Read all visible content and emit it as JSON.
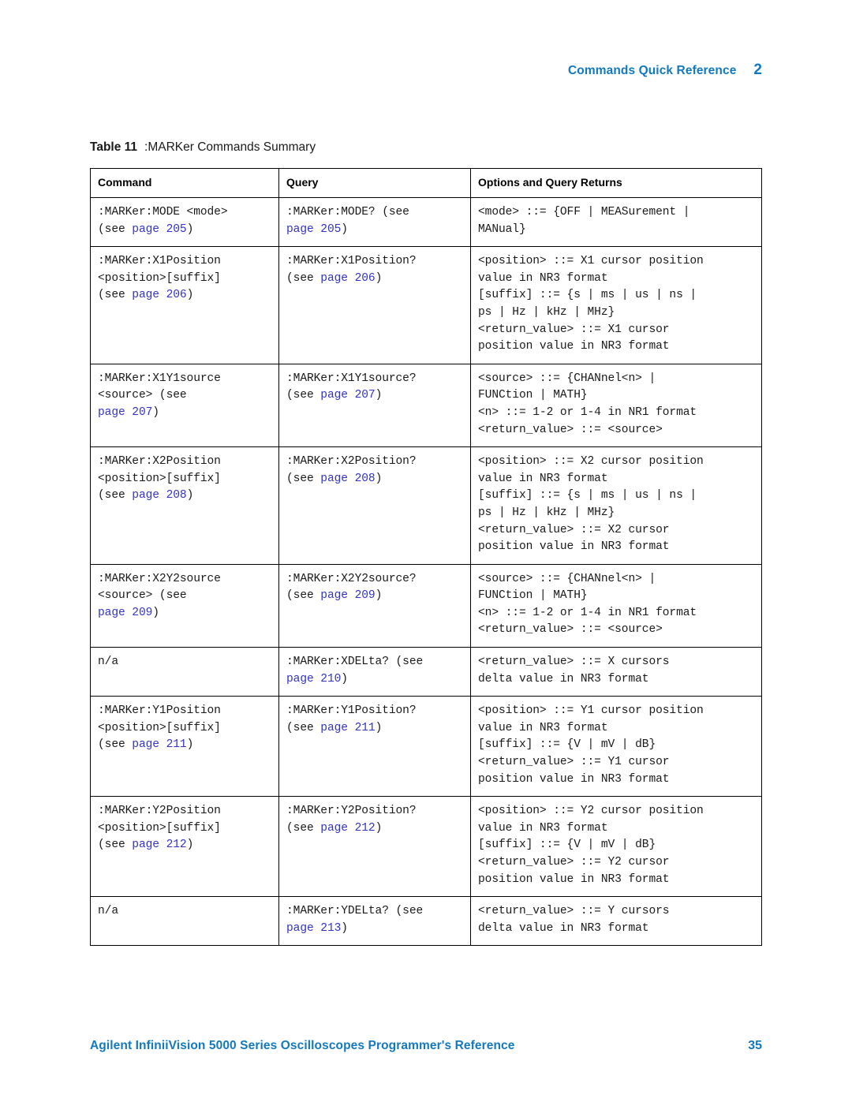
{
  "header": {
    "title": "Commands Quick Reference",
    "chapter": "2"
  },
  "caption": {
    "label": "Table 11",
    "text": ":MARKer Commands Summary"
  },
  "table": {
    "columns": [
      "Command",
      "Query",
      "Options and Query Returns"
    ],
    "rows": [
      {
        "command": [
          [
            {
              "t": ":MARKer:MODE <mode>"
            }
          ],
          [
            {
              "t": "(see "
            },
            {
              "t": "page 205",
              "link": true
            },
            {
              "t": ")"
            }
          ]
        ],
        "query": [
          [
            {
              "t": ":MARKer:MODE? (see"
            }
          ],
          [
            {
              "t": "page 205",
              "link": true
            },
            {
              "t": ")"
            }
          ]
        ],
        "options": [
          [
            {
              "t": "<mode> ::= {OFF | MEASurement |"
            }
          ],
          [
            {
              "t": "MANual}"
            }
          ]
        ]
      },
      {
        "command": [
          [
            {
              "t": ":MARKer:X1Position"
            }
          ],
          [
            {
              "t": "<position>[suffix]"
            }
          ],
          [
            {
              "t": "(see "
            },
            {
              "t": "page 206",
              "link": true
            },
            {
              "t": ")"
            }
          ]
        ],
        "query": [
          [
            {
              "t": ":MARKer:X1Position?"
            }
          ],
          [
            {
              "t": "(see "
            },
            {
              "t": "page 206",
              "link": true
            },
            {
              "t": ")"
            }
          ]
        ],
        "options": [
          [
            {
              "t": "<position> ::= X1 cursor position"
            }
          ],
          [
            {
              "t": "value in NR3 format"
            }
          ],
          [
            {
              "t": "[suffix] ::= {s | ms | us | ns |"
            }
          ],
          [
            {
              "t": "ps | Hz | kHz | MHz}"
            }
          ],
          [
            {
              "t": "<return_value> ::= X1 cursor"
            }
          ],
          [
            {
              "t": "position value in NR3 format"
            }
          ]
        ]
      },
      {
        "command": [
          [
            {
              "t": ":MARKer:X1Y1source"
            }
          ],
          [
            {
              "t": "<source> (see"
            }
          ],
          [
            {
              "t": "page 207",
              "link": true
            },
            {
              "t": ")"
            }
          ]
        ],
        "query": [
          [
            {
              "t": ":MARKer:X1Y1source?"
            }
          ],
          [
            {
              "t": "(see "
            },
            {
              "t": "page 207",
              "link": true
            },
            {
              "t": ")"
            }
          ]
        ],
        "options": [
          [
            {
              "t": "<source> ::= {CHANnel<n> |"
            }
          ],
          [
            {
              "t": "FUNCtion | MATH}"
            }
          ],
          [
            {
              "t": "<n> ::= 1-2 or 1-4 in NR1 format"
            }
          ],
          [
            {
              "t": "<return_value> ::= <source>"
            }
          ]
        ]
      },
      {
        "command": [
          [
            {
              "t": ":MARKer:X2Position"
            }
          ],
          [
            {
              "t": "<position>[suffix]"
            }
          ],
          [
            {
              "t": "(see "
            },
            {
              "t": "page 208",
              "link": true
            },
            {
              "t": ")"
            }
          ]
        ],
        "query": [
          [
            {
              "t": ":MARKer:X2Position?"
            }
          ],
          [
            {
              "t": "(see "
            },
            {
              "t": "page 208",
              "link": true
            },
            {
              "t": ")"
            }
          ]
        ],
        "options": [
          [
            {
              "t": "<position> ::= X2 cursor position"
            }
          ],
          [
            {
              "t": "value in NR3 format"
            }
          ],
          [
            {
              "t": "[suffix] ::= {s | ms | us | ns |"
            }
          ],
          [
            {
              "t": "ps | Hz | kHz | MHz}"
            }
          ],
          [
            {
              "t": "<return_value> ::= X2 cursor"
            }
          ],
          [
            {
              "t": "position value in NR3 format"
            }
          ]
        ]
      },
      {
        "command": [
          [
            {
              "t": ":MARKer:X2Y2source"
            }
          ],
          [
            {
              "t": "<source> (see"
            }
          ],
          [
            {
              "t": "page 209",
              "link": true
            },
            {
              "t": ")"
            }
          ]
        ],
        "query": [
          [
            {
              "t": ":MARKer:X2Y2source?"
            }
          ],
          [
            {
              "t": "(see "
            },
            {
              "t": "page 209",
              "link": true
            },
            {
              "t": ")"
            }
          ]
        ],
        "options": [
          [
            {
              "t": "<source> ::= {CHANnel<n> |"
            }
          ],
          [
            {
              "t": "FUNCtion | MATH}"
            }
          ],
          [
            {
              "t": "<n> ::= 1-2 or 1-4 in NR1 format"
            }
          ],
          [
            {
              "t": "<return_value> ::= <source>"
            }
          ]
        ]
      },
      {
        "command": [
          [
            {
              "t": "n/a"
            }
          ]
        ],
        "query": [
          [
            {
              "t": ":MARKer:XDELta? (see"
            }
          ],
          [
            {
              "t": "page 210",
              "link": true
            },
            {
              "t": ")"
            }
          ]
        ],
        "options": [
          [
            {
              "t": "<return_value> ::= X cursors"
            }
          ],
          [
            {
              "t": "delta value in NR3 format"
            }
          ]
        ]
      },
      {
        "command": [
          [
            {
              "t": ":MARKer:Y1Position"
            }
          ],
          [
            {
              "t": "<position>[suffix]"
            }
          ],
          [
            {
              "t": "(see "
            },
            {
              "t": "page 211",
              "link": true
            },
            {
              "t": ")"
            }
          ]
        ],
        "query": [
          [
            {
              "t": ":MARKer:Y1Position?"
            }
          ],
          [
            {
              "t": "(see "
            },
            {
              "t": "page 211",
              "link": true
            },
            {
              "t": ")"
            }
          ]
        ],
        "options": [
          [
            {
              "t": "<position> ::= Y1 cursor position"
            }
          ],
          [
            {
              "t": "value in NR3 format"
            }
          ],
          [
            {
              "t": "[suffix] ::= {V | mV | dB}"
            }
          ],
          [
            {
              "t": "<return_value> ::= Y1 cursor"
            }
          ],
          [
            {
              "t": "position value in NR3 format"
            }
          ]
        ]
      },
      {
        "command": [
          [
            {
              "t": ":MARKer:Y2Position"
            }
          ],
          [
            {
              "t": "<position>[suffix]"
            }
          ],
          [
            {
              "t": "(see "
            },
            {
              "t": "page 212",
              "link": true
            },
            {
              "t": ")"
            }
          ]
        ],
        "query": [
          [
            {
              "t": ":MARKer:Y2Position?"
            }
          ],
          [
            {
              "t": "(see "
            },
            {
              "t": "page 212",
              "link": true
            },
            {
              "t": ")"
            }
          ]
        ],
        "options": [
          [
            {
              "t": "<position> ::= Y2 cursor position"
            }
          ],
          [
            {
              "t": "value in NR3 format"
            }
          ],
          [
            {
              "t": "[suffix] ::= {V | mV | dB}"
            }
          ],
          [
            {
              "t": "<return_value> ::= Y2 cursor"
            }
          ],
          [
            {
              "t": "position value in NR3 format"
            }
          ]
        ]
      },
      {
        "command": [
          [
            {
              "t": "n/a"
            }
          ]
        ],
        "query": [
          [
            {
              "t": ":MARKer:YDELta? (see"
            }
          ],
          [
            {
              "t": "page 213",
              "link": true
            },
            {
              "t": ")"
            }
          ]
        ],
        "options": [
          [
            {
              "t": "<return_value> ::= Y cursors"
            }
          ],
          [
            {
              "t": "delta value in NR3 format"
            }
          ]
        ]
      }
    ]
  },
  "footer": {
    "title": "Agilent InfiniiVision 5000 Series Oscilloscopes Programmer's Reference",
    "page_number": "35"
  },
  "colors": {
    "accent_blue": "#1379bf",
    "link_blue": "#3333cc",
    "text": "#1a1a1a",
    "rule": "#000000"
  }
}
